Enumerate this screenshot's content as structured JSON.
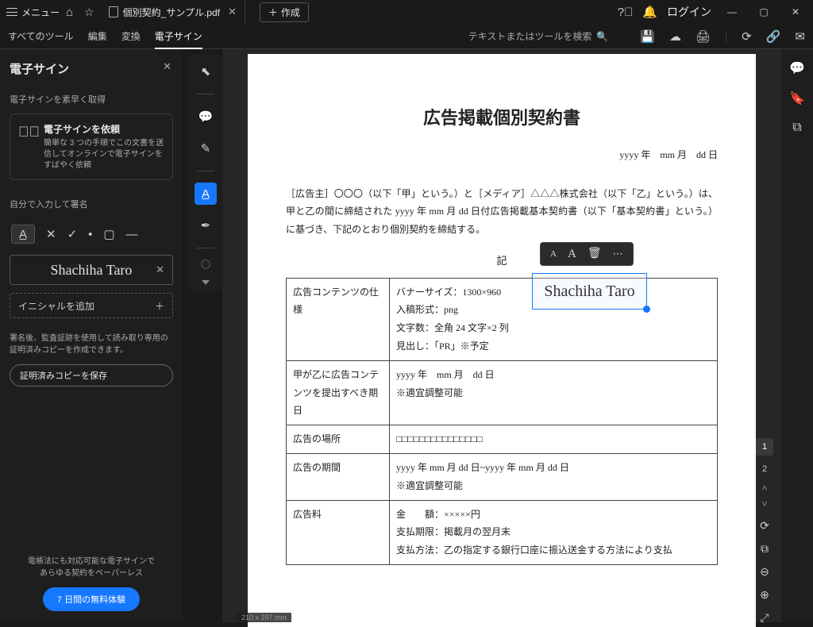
{
  "titlebar": {
    "menu_label": "メニュー",
    "tab_name": "個別契約_サンプル.pdf",
    "create_label": "作成",
    "login_label": "ログイン"
  },
  "toolbar": {
    "all_tools": "すべてのツール",
    "edit": "編集",
    "convert": "変換",
    "esign": "電子サイン",
    "search_placeholder": "テキストまたはツールを検索"
  },
  "panel": {
    "title": "電子サイン",
    "quick_get": "電子サインを素早く取得",
    "request_title": "電子サインを依頼",
    "request_desc": "簡単な 3 つの手順でこの文書を送信してオンラインで電子サインをすばやく依頼",
    "self_sign": "自分で入力して署名",
    "sample_name": "Shachiha Taro",
    "add_initials": "イニシャルを追加",
    "after_sign_note": "署名後、監査証跡を使用して読み取り専用の証明済みコピーを作成できます。",
    "save_cert": "証明済みコピーを保存",
    "bottom_msg": "電帳法にも対応可能な電子サインで\nあらゆる契約をペーパーレス",
    "trial": "7 日間の無料体験"
  },
  "sig": {
    "name": "Shachiha Taro"
  },
  "doc": {
    "title": "広告掲載個別契約書",
    "date": "yyyy 年　mm 月　dd 日",
    "paragraph": "［広告主］〇〇〇（以下「甲」という。）と［メディア］△△△株式会社（以下「乙」という。）は、甲と乙の間に締結された yyyy 年 mm 月 dd 日付広告掲載基本契約書（以下「基本契約書」という。）に基づき、下記のとおり個別契約を締結する。",
    "ki": "記",
    "rows": [
      {
        "l": "広告コンテンツの仕様",
        "r": "バナーサイズ：1300×960\n入稿形式：png\n文字数：全角 24 文字×2 列\n見出し：「PR」※予定"
      },
      {
        "l": "甲が乙に広告コンテンツを提出すべき期日",
        "r": "yyyy 年　mm 月　dd 日\n※適宜調整可能"
      },
      {
        "l": "広告の場所",
        "r": "□□□□□□□□□□□□□□□"
      },
      {
        "l": "広告の期間",
        "r": "yyyy 年 mm 月 dd 日~yyyy 年 mm 月 dd 日\n※適宜調整可能"
      },
      {
        "l": "広告料",
        "r": "金　　額：×××××円\n支払期限：掲載月の翌月末\n支払方法：乙の指定する銀行口座に振込送金する方法により支払"
      }
    ]
  },
  "nav": {
    "p1": "1",
    "p2": "2"
  },
  "status": {
    "size": "210 x 297 mm"
  }
}
